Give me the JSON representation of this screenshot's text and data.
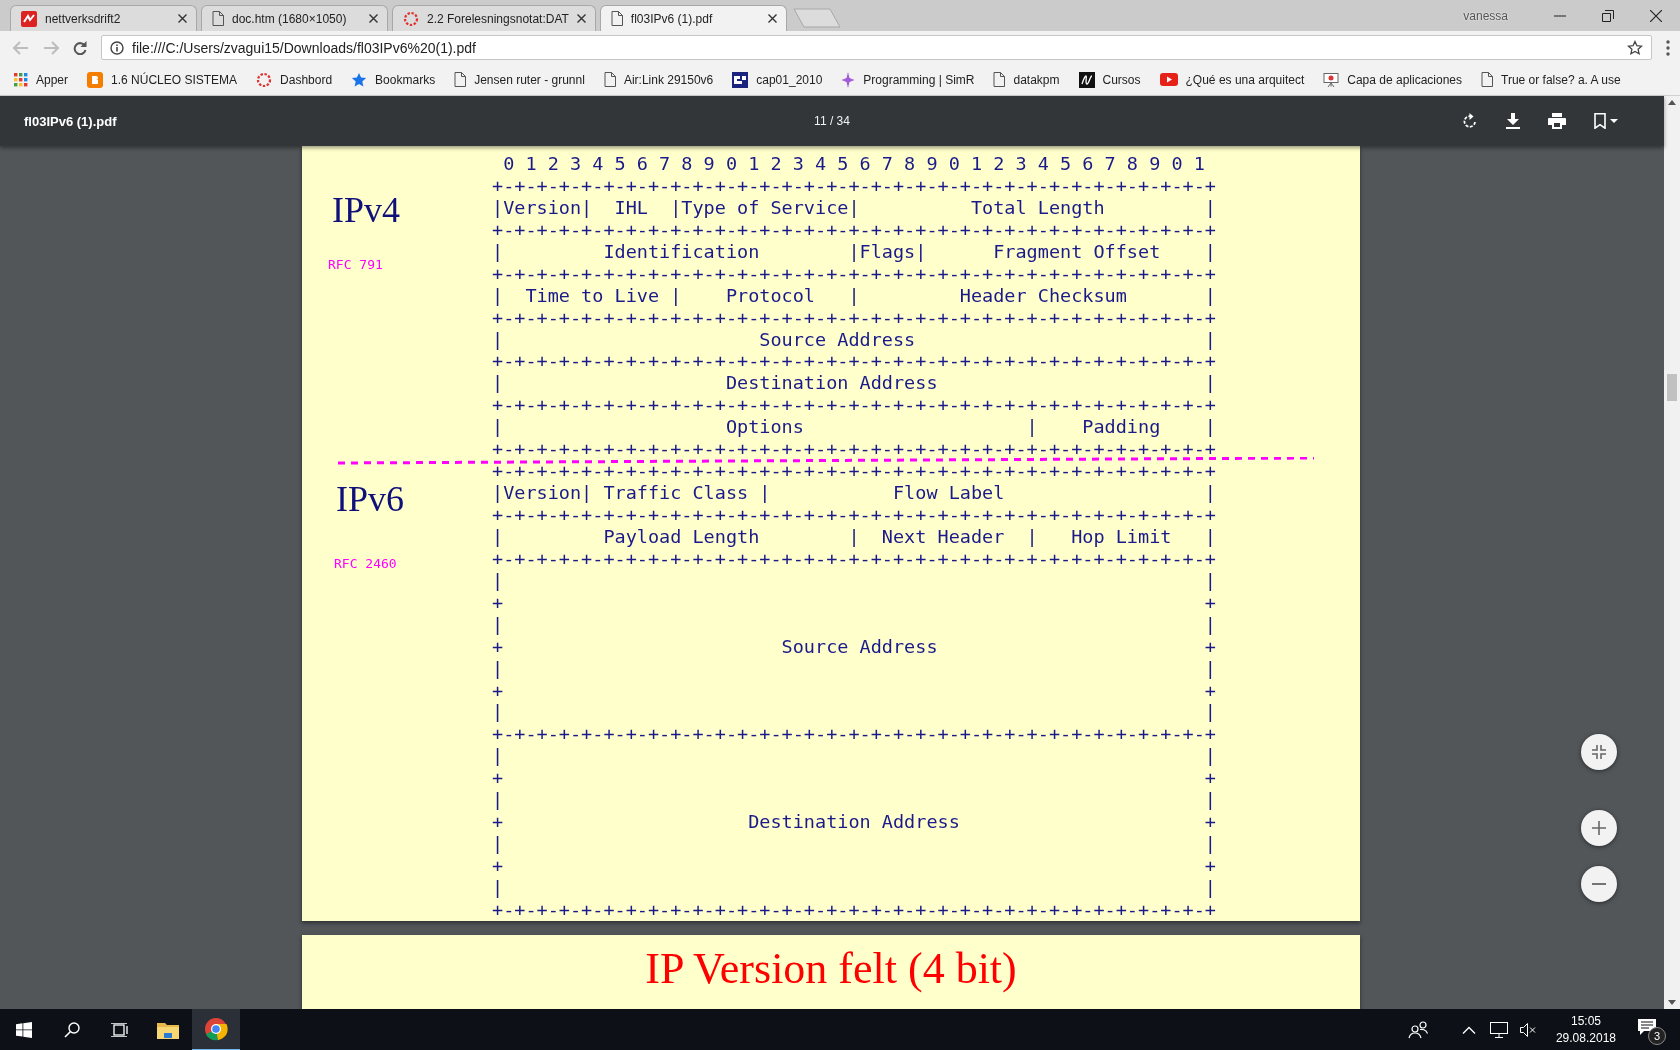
{
  "browser": {
    "tabs": [
      {
        "title": "nettverksdrift2",
        "kind": "app",
        "selected": false
      },
      {
        "title": "doc.htm (1680×1050)",
        "kind": "page",
        "selected": false
      },
      {
        "title": "2.2 Forelesningsnotat:DAT",
        "kind": "spinner",
        "selected": false
      },
      {
        "title": "fl03IPv6 (1).pdf",
        "kind": "page",
        "selected": true
      }
    ],
    "user": "vanessa",
    "back_disabled": true,
    "forward_disabled": true,
    "address": "file:///C:/Users/zvagui15/Downloads/fl03IPv6%20(1).pdf",
    "bookmarks": [
      {
        "label": "Apper",
        "kind": "apps"
      },
      {
        "label": "1.6 NÚCLEO SISTEMA",
        "kind": "blogger"
      },
      {
        "label": "Dashbord",
        "kind": "spinner"
      },
      {
        "label": "Bookmarks",
        "kind": "star"
      },
      {
        "label": "Jensen ruter - grunnl",
        "kind": "page"
      },
      {
        "label": "Air:Link 29150v6",
        "kind": "page"
      },
      {
        "label": "cap01_2010",
        "kind": "logo"
      },
      {
        "label": "Programming | SimR",
        "kind": "sparkle"
      },
      {
        "label": "datakpm",
        "kind": "page"
      },
      {
        "label": "Cursos",
        "kind": "script"
      },
      {
        "label": "¿Qué es una arquitect",
        "kind": "video"
      },
      {
        "label": "Capa de aplicaciones",
        "kind": "easel"
      },
      {
        "label": "True or false? a. A use",
        "kind": "page"
      }
    ]
  },
  "pdf_viewer": {
    "file_name": "fl03IPv6 (1).pdf",
    "page_indicator": "11 / 34",
    "sections": [
      {
        "title": "IPv4",
        "reference": "RFC 791"
      },
      {
        "title": "IPv6",
        "reference": "RFC 2460"
      }
    ],
    "diagram_lines": [
      " 0 1 2 3 4 5 6 7 8 9 0 1 2 3 4 5 6 7 8 9 0 1 2 3 4 5 6 7 8 9 0 1",
      "+-+-+-+-+-+-+-+-+-+-+-+-+-+-+-+-+-+-+-+-+-+-+-+-+-+-+-+-+-+-+-+-+",
      "|Version|  IHL  |Type of Service|          Total Length         |",
      "+-+-+-+-+-+-+-+-+-+-+-+-+-+-+-+-+-+-+-+-+-+-+-+-+-+-+-+-+-+-+-+-+",
      "|         Identification        |Flags|      Fragment Offset    |",
      "+-+-+-+-+-+-+-+-+-+-+-+-+-+-+-+-+-+-+-+-+-+-+-+-+-+-+-+-+-+-+-+-+",
      "|  Time to Live |    Protocol   |         Header Checksum       |",
      "+-+-+-+-+-+-+-+-+-+-+-+-+-+-+-+-+-+-+-+-+-+-+-+-+-+-+-+-+-+-+-+-+",
      "|                       Source Address                          |",
      "+-+-+-+-+-+-+-+-+-+-+-+-+-+-+-+-+-+-+-+-+-+-+-+-+-+-+-+-+-+-+-+-+",
      "|                    Destination Address                        |",
      "+-+-+-+-+-+-+-+-+-+-+-+-+-+-+-+-+-+-+-+-+-+-+-+-+-+-+-+-+-+-+-+-+",
      "|                    Options                    |    Padding    |",
      "+-+-+-+-+-+-+-+-+-+-+-+-+-+-+-+-+-+-+-+-+-+-+-+-+-+-+-+-+-+-+-+-+",
      "+-+-+-+-+-+-+-+-+-+-+-+-+-+-+-+-+-+-+-+-+-+-+-+-+-+-+-+-+-+-+-+-+",
      "|Version| Traffic Class |           Flow Label                  |",
      "+-+-+-+-+-+-+-+-+-+-+-+-+-+-+-+-+-+-+-+-+-+-+-+-+-+-+-+-+-+-+-+-+",
      "|         Payload Length        |  Next Header  |   Hop Limit   |",
      "+-+-+-+-+-+-+-+-+-+-+-+-+-+-+-+-+-+-+-+-+-+-+-+-+-+-+-+-+-+-+-+-+",
      "|                                                               |",
      "+                                                               +",
      "|                                                               |",
      "+                         Source Address                        +",
      "|                                                               |",
      "+                                                               +",
      "|                                                               |",
      "+-+-+-+-+-+-+-+-+-+-+-+-+-+-+-+-+-+-+-+-+-+-+-+-+-+-+-+-+-+-+-+-+",
      "|                                                               |",
      "+                                                               +",
      "|                                                               |",
      "+                      Destination Address                      +",
      "|                                                               |",
      "+                                                               +",
      "|                                                               |",
      "+-+-+-+-+-+-+-+-+-+-+-+-+-+-+-+-+-+-+-+-+-+-+-+-+-+-+-+-+-+-+-+-+"
    ],
    "next_page_heading": "IP Version felt (4 bit)"
  },
  "taskbar": {
    "apps": [
      {
        "kind": "folder",
        "selected": false
      },
      {
        "kind": "browser",
        "selected": true
      }
    ],
    "time": "15:05",
    "date": "29.08.2018",
    "notification_count": "3"
  }
}
